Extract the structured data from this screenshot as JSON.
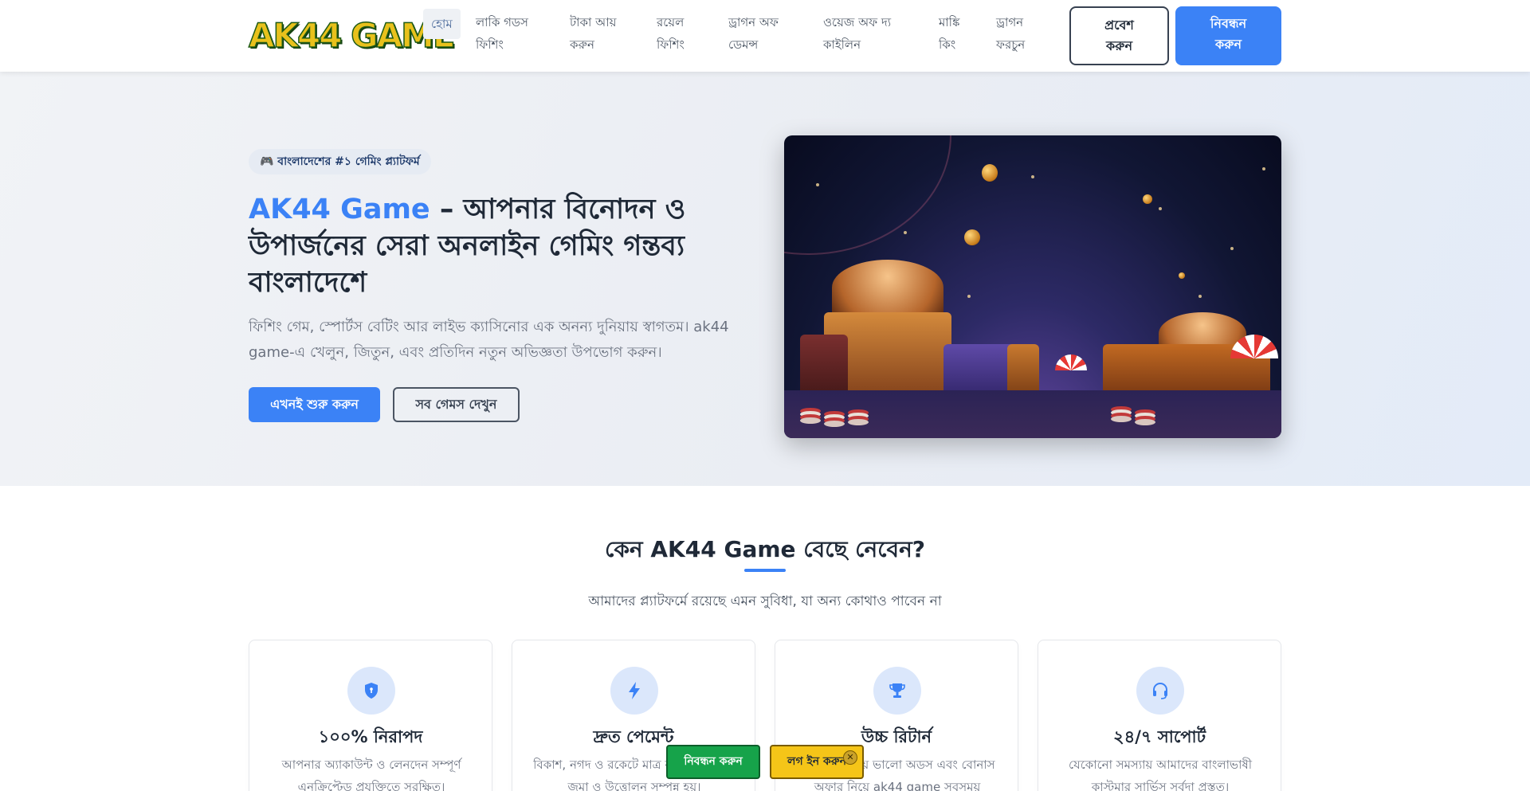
{
  "brand": {
    "logo_text": "AK44 GAME"
  },
  "nav": {
    "items": [
      {
        "line1": "হোম",
        "line2": ""
      },
      {
        "line1": "লাকি গডস",
        "line2": "ফিশিং"
      },
      {
        "line1": "টাকা আয়",
        "line2": "করুন"
      },
      {
        "line1": "রয়েল",
        "line2": "ফিশিং"
      },
      {
        "line1": "ড্রাগন অফ",
        "line2": "ডেমন্স"
      },
      {
        "line1": "ওয়েজ অফ দ্য",
        "line2": "কাইলিন"
      },
      {
        "line1": "মাঙ্কি",
        "line2": "কিং"
      },
      {
        "line1": "ড্রাগন",
        "line2": "ফরচুন"
      }
    ],
    "login": {
      "line1": "প্রবেশ",
      "line2": "করুন"
    },
    "register": {
      "line1": "নিবন্ধন",
      "line2": "করুন"
    }
  },
  "hero": {
    "badge": "🎮 বাংলাদেশের #১ গেমিং প্ল্যাটফর্ম",
    "title_accent": "AK44 Game",
    "title_rest": " – আপনার বিনোদন ও উপার্জনের সেরা অনলাইন গেমিং গন্তব্য বাংলাদেশে",
    "description": "ফিশিং গেম, স্পোর্টস বেটিং আর লাইভ ক্যাসিনোর এক অনন্য দুনিয়ায় স্বাগতম। ak44 game-এ খেলুন, জিতুন, এবং প্রতিদিন নতুন অভিজ্ঞতা উপভোগ করুন।",
    "cta_primary": "এখনই শুরু করুন",
    "cta_secondary": "সব গেমস দেখুন"
  },
  "features": {
    "title": "কেন AK44 Game বেছে নেবেন?",
    "subtitle": "আমাদের প্ল্যাটফর্মে রয়েছে এমন সুবিধা, যা অন্য কোথাও পাবেন না",
    "cards": [
      {
        "icon": "shield-icon",
        "title": "১০০% নিরাপদ",
        "desc": "আপনার অ্যাকাউন্ট ও লেনদেন সম্পূর্ণ এনক্রিপ্টেড প্রযুক্তিতে সুরক্ষিত।"
      },
      {
        "icon": "lightning-icon",
        "title": "দ্রুত পেমেন্ট",
        "desc": "বিকাশ, নগদ ও রকেটে মাত্র কয়েক মিনিটেই জমা ও উত্তোলন সম্পন্ন হয়।"
      },
      {
        "icon": "trophy-icon",
        "title": "উচ্চ রিটার্ন",
        "desc": "বাজারের চেয়ে ভালো অডস এবং বোনাস অফার নিয়ে ak44 game সবসময়"
      },
      {
        "icon": "headset-icon",
        "title": "২৪/৭ সাপোর্ট",
        "desc": "যেকোনো সমস্যায় আমাদের বাংলাভাষী কাস্টমার সার্ভিস সর্বদা প্রস্তুত।"
      }
    ]
  },
  "floating": {
    "register": "নিবন্ধন করুন",
    "login": "লগ ইন করুন",
    "close": "✕"
  },
  "colors": {
    "accent": "#3b82f6",
    "register_float": "#16a34a",
    "login_float": "#f5c518"
  }
}
